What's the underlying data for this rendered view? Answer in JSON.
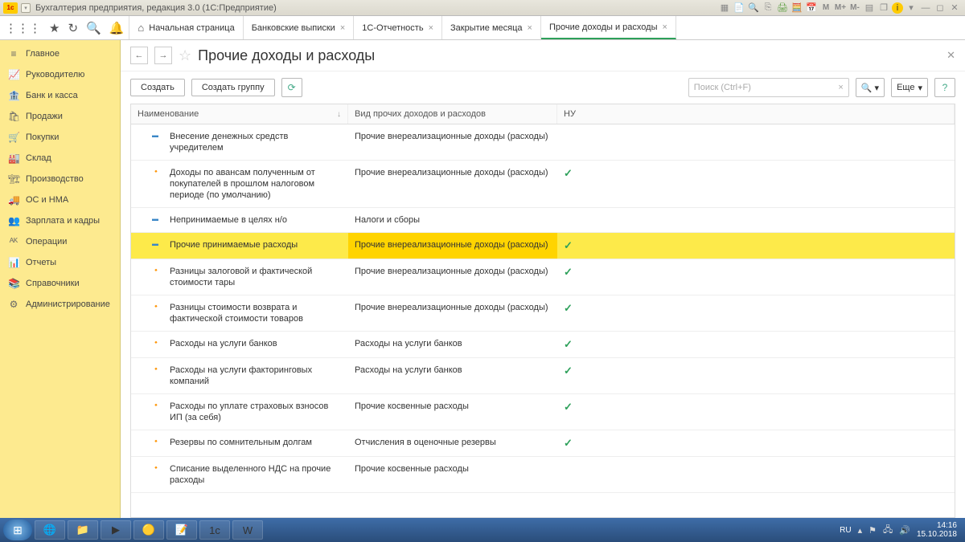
{
  "titlebar": {
    "app_title": "Бухгалтерия предприятия, редакция 3.0  (1С:Предприятие)"
  },
  "tabs": [
    {
      "label": "Начальная страница",
      "closable": false,
      "home": true
    },
    {
      "label": "Банковские выписки",
      "closable": true
    },
    {
      "label": "1С-Отчетность",
      "closable": true
    },
    {
      "label": "Закрытие месяца",
      "closable": true
    },
    {
      "label": "Прочие доходы и расходы",
      "closable": true,
      "active": true
    }
  ],
  "sidebar": [
    {
      "icon": "≡",
      "label": "Главное"
    },
    {
      "icon": "📈",
      "label": "Руководителю"
    },
    {
      "icon": "🏦",
      "label": "Банк и касса"
    },
    {
      "icon": "🛍",
      "label": "Продажи"
    },
    {
      "icon": "🛒",
      "label": "Покупки"
    },
    {
      "icon": "🏭",
      "label": "Склад"
    },
    {
      "icon": "🏗",
      "label": "Производство"
    },
    {
      "icon": "🚚",
      "label": "ОС и НМА"
    },
    {
      "icon": "👥",
      "label": "Зарплата и кадры"
    },
    {
      "icon": "ᴬᴷ",
      "label": "Операции"
    },
    {
      "icon": "📊",
      "label": "Отчеты"
    },
    {
      "icon": "📚",
      "label": "Справочники"
    },
    {
      "icon": "⚙",
      "label": "Администрирование"
    }
  ],
  "page": {
    "title": "Прочие доходы и расходы",
    "btn_create": "Создать",
    "btn_create_group": "Создать группу",
    "search_placeholder": "Поиск (Ctrl+F)",
    "btn_more": "Еще"
  },
  "columns": {
    "c1": "Наименование",
    "c2": "Вид прочих доходов и расходов",
    "c3": "НУ"
  },
  "rows": [
    {
      "icon": "blue",
      "name": "Внесение денежных средств учредителем",
      "kind": "Прочие внереализационные доходы (расходы)",
      "nu": false
    },
    {
      "icon": "gold",
      "name": "Доходы по авансам полученным от покупателей в прошлом налоговом периоде (по умолчанию)",
      "kind": "Прочие внереализационные доходы (расходы)",
      "nu": true
    },
    {
      "icon": "blue",
      "name": "Непринимаемые в целях н/о",
      "kind": "Налоги и сборы",
      "nu": false
    },
    {
      "icon": "blue",
      "name": "Прочие принимаемые расходы",
      "kind": "Прочие внереализационные доходы (расходы)",
      "nu": true,
      "selected": true
    },
    {
      "icon": "gold",
      "name": "Разницы залоговой и фактической стоимости тары",
      "kind": "Прочие внереализационные доходы (расходы)",
      "nu": true
    },
    {
      "icon": "gold",
      "name": "Разницы стоимости возврата и фактической стоимости товаров",
      "kind": "Прочие внереализационные доходы (расходы)",
      "nu": true
    },
    {
      "icon": "gold",
      "name": "Расходы на услуги банков",
      "kind": "Расходы на услуги банков",
      "nu": true
    },
    {
      "icon": "gold",
      "name": "Расходы на услуги факторинговых компаний",
      "kind": "Расходы на услуги банков",
      "nu": true
    },
    {
      "icon": "gold",
      "name": "Расходы по уплате страховых взносов ИП (за себя)",
      "kind": "Прочие косвенные расходы",
      "nu": true
    },
    {
      "icon": "gold",
      "name": "Резервы по сомнительным долгам",
      "kind": "Отчисления в оценочные резервы",
      "nu": true
    },
    {
      "icon": "gold",
      "name": "Списание выделенного НДС на прочие расходы",
      "kind": "Прочие косвенные расходы",
      "nu": false
    }
  ],
  "tray": {
    "lang": "RU",
    "time": "14:16",
    "date": "15.10.2018"
  }
}
